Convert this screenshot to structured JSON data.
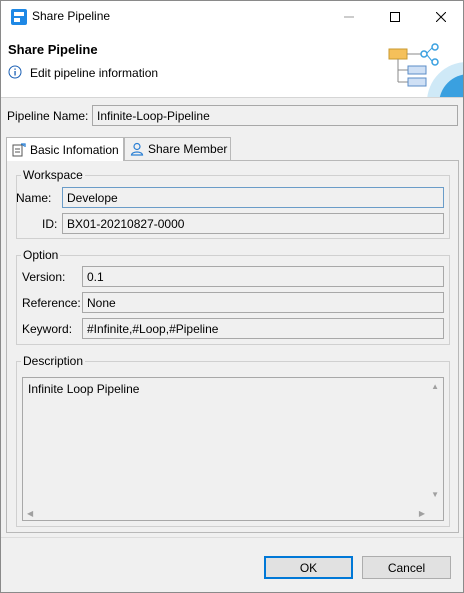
{
  "window": {
    "title": "Share Pipeline"
  },
  "banner": {
    "title": "Share Pipeline",
    "message": "Edit pipeline information"
  },
  "pipeline": {
    "label": "Pipeline Name:",
    "value": "Infinite-Loop-Pipeline"
  },
  "tabs": [
    {
      "label": "Basic Infomation",
      "icon": "document-edit-icon",
      "active": true
    },
    {
      "label": "Share Member",
      "icon": "user-icon",
      "active": false
    }
  ],
  "workspace": {
    "title": "Workspace",
    "name_label": "Name:",
    "name_value": "Develope",
    "id_label": "ID:",
    "id_value": "BX01-20210827-0000"
  },
  "option": {
    "title": "Option",
    "version_label": "Version:",
    "version_value": "0.1",
    "reference_label": "Reference:",
    "reference_value": "None",
    "keyword_label": "Keyword:",
    "keyword_value": "#Infinite,#Loop,#Pipeline"
  },
  "description": {
    "title": "Description",
    "value": "Infinite Loop Pipeline"
  },
  "buttons": {
    "ok": "OK",
    "cancel": "Cancel"
  },
  "colors": {
    "accent": "#0078d7",
    "banner_art_blue": "#3aa0e0",
    "banner_art_orange": "#f5c05a"
  }
}
